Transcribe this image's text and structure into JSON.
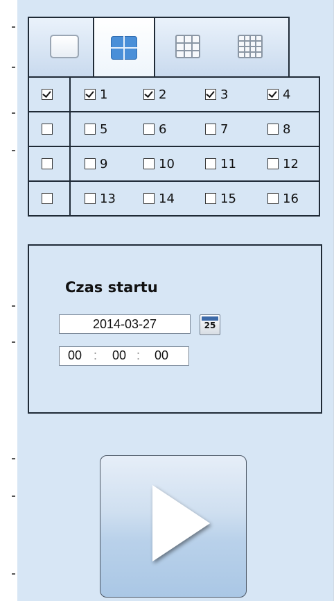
{
  "tabs": [
    {
      "icon": "single-view-icon",
      "active": false
    },
    {
      "icon": "quad-view-icon",
      "active": true
    },
    {
      "icon": "grid9-view-icon",
      "active": false
    },
    {
      "icon": "grid16-view-icon",
      "active": false
    }
  ],
  "channels": {
    "rows": [
      {
        "all_checked": true,
        "items": [
          {
            "label": "1",
            "checked": true
          },
          {
            "label": "2",
            "checked": true
          },
          {
            "label": "3",
            "checked": true
          },
          {
            "label": "4",
            "checked": true
          }
        ]
      },
      {
        "all_checked": false,
        "items": [
          {
            "label": "5",
            "checked": false
          },
          {
            "label": "6",
            "checked": false
          },
          {
            "label": "7",
            "checked": false
          },
          {
            "label": "8",
            "checked": false
          }
        ]
      },
      {
        "all_checked": false,
        "items": [
          {
            "label": "9",
            "checked": false
          },
          {
            "label": "10",
            "checked": false
          },
          {
            "label": "11",
            "checked": false
          },
          {
            "label": "12",
            "checked": false
          }
        ]
      },
      {
        "all_checked": false,
        "items": [
          {
            "label": "13",
            "checked": false
          },
          {
            "label": "14",
            "checked": false
          },
          {
            "label": "15",
            "checked": false
          },
          {
            "label": "16",
            "checked": false
          }
        ]
      }
    ]
  },
  "start_time": {
    "title": "Czas startu",
    "date": "2014-03-27",
    "calendar_icon_day": "25",
    "hours": "00",
    "minutes": "00",
    "seconds": "00",
    "separator": ":"
  },
  "play_button": {
    "icon": "play-icon"
  },
  "colors": {
    "panel_bg": "#d7e6f5",
    "border": "#1f2a36",
    "quad_icon": "#4a8fd8"
  }
}
